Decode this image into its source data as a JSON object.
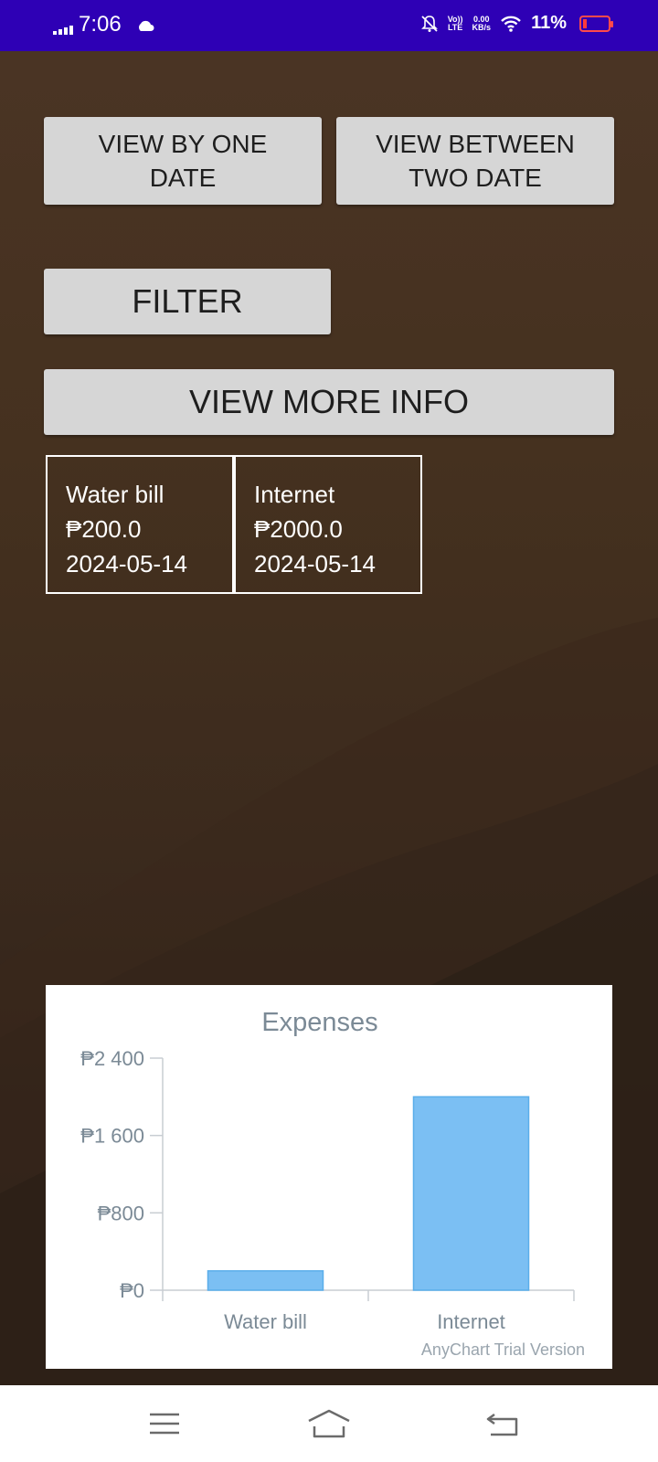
{
  "status_bar": {
    "time": "7:06",
    "network_top": "0.00",
    "network_bottom": "KB/s",
    "volte_top": "Vo))",
    "volte_bottom": "LTE",
    "battery_percent": "11%",
    "icons": [
      "signal-icon",
      "cloud-icon",
      "mute-bell-icon",
      "volte-icon",
      "wifi-icon",
      "battery-icon"
    ]
  },
  "buttons": {
    "view_one_date": "VIEW BY ONE DATE",
    "view_two_date": "VIEW BETWEEN TWO DATE",
    "filter": "FILTER",
    "view_more": "VIEW MORE INFO"
  },
  "expenses": [
    {
      "name": "Water bill",
      "amount": "₱200.0",
      "date": "2024-05-14"
    },
    {
      "name": "Internet",
      "amount": "₱2000.0",
      "date": "2024-05-14"
    }
  ],
  "chart_data": {
    "type": "bar",
    "title": "Expenses",
    "categories": [
      "Water bill",
      "Internet"
    ],
    "values": [
      200,
      2000
    ],
    "ylim": [
      0,
      2400
    ],
    "yticks": [
      0,
      800,
      1600,
      2400
    ],
    "ytick_labels": [
      "₱0",
      "₱800",
      "₱1 600",
      "₱2 400"
    ],
    "color": "#7bbff3",
    "grid": false,
    "watermark": "AnyChart Trial Version"
  },
  "nav_bar": {
    "icons": [
      "menu-icon",
      "home-icon",
      "back-icon"
    ]
  }
}
